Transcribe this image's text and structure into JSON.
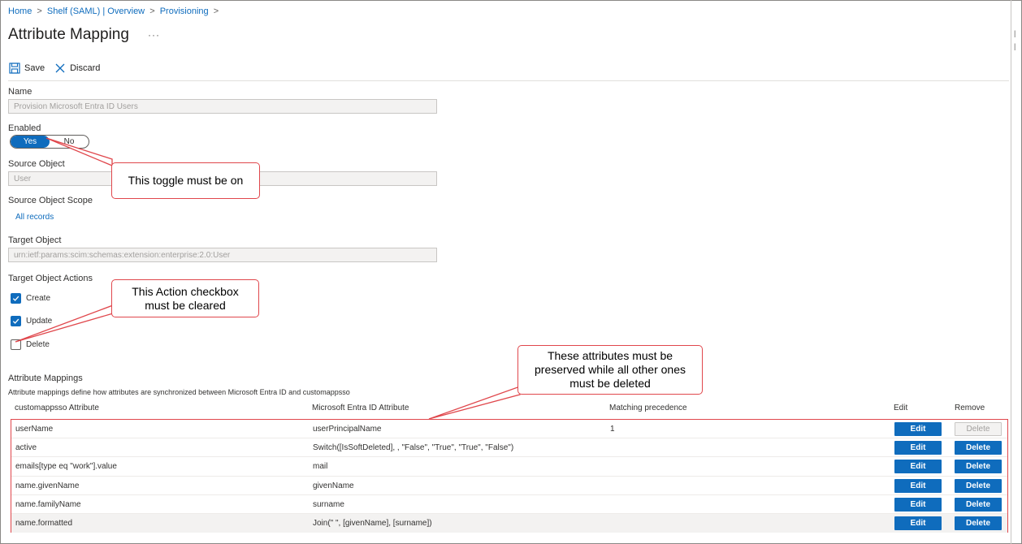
{
  "breadcrumb": {
    "items": [
      "Home",
      "Shelf (SAML) | Overview",
      "Provisioning"
    ],
    "sep": ">"
  },
  "page": {
    "title": "Attribute Mapping",
    "more": "···"
  },
  "toolbar": {
    "save_label": "Save",
    "discard_label": "Discard"
  },
  "form": {
    "name_label": "Name",
    "name_value": "Provision Microsoft Entra ID Users",
    "enabled_label": "Enabled",
    "toggle_yes": "Yes",
    "toggle_no": "No",
    "source_label": "Source Object",
    "source_value": "User",
    "scope_label": "Source Object Scope",
    "scope_link": "All records",
    "target_label": "Target Object",
    "target_value": "urn:ietf:params:scim:schemas:extension:enterprise:2.0:User",
    "actions_label": "Target Object Actions",
    "actions": [
      {
        "label": "Create",
        "checked": true
      },
      {
        "label": "Update",
        "checked": true
      },
      {
        "label": "Delete",
        "checked": false
      }
    ]
  },
  "mappings": {
    "title": "Attribute Mappings",
    "description": "Attribute mappings define how attributes are synchronized between Microsoft Entra ID and customappsso",
    "headers": [
      "customappsso Attribute",
      "Microsoft Entra ID Attribute",
      "Matching precedence",
      "Edit",
      "Remove"
    ],
    "edit_label": "Edit",
    "delete_label": "Delete",
    "rows": [
      {
        "target": "userName",
        "source": "userPrincipalName",
        "precedence": "1",
        "delete_disabled": true
      },
      {
        "target": "active",
        "source": "Switch([IsSoftDeleted], , \"False\", \"True\", \"True\", \"False\")",
        "precedence": "",
        "delete_disabled": false
      },
      {
        "target": "emails[type eq \"work\"].value",
        "source": "mail",
        "precedence": "",
        "delete_disabled": false
      },
      {
        "target": "name.givenName",
        "source": "givenName",
        "precedence": "",
        "delete_disabled": false
      },
      {
        "target": "name.familyName",
        "source": "surname",
        "precedence": "",
        "delete_disabled": false
      },
      {
        "target": "name.formatted",
        "source": "Join(\" \", [givenName], [surname])",
        "precedence": "",
        "delete_disabled": false
      }
    ]
  },
  "callouts": {
    "toggle_note": "This toggle must be on",
    "delete_note_line1": "This Action checkbox",
    "delete_note_line2": "must be cleared",
    "attr_note_line1": "These attributes must be",
    "attr_note_line2": "preserved while all other ones",
    "attr_note_line3": "must be deleted"
  },
  "side_marks": [
    "|",
    "|"
  ],
  "colors": {
    "accent": "#0f6cbd",
    "callout_border": "#e0474c"
  }
}
